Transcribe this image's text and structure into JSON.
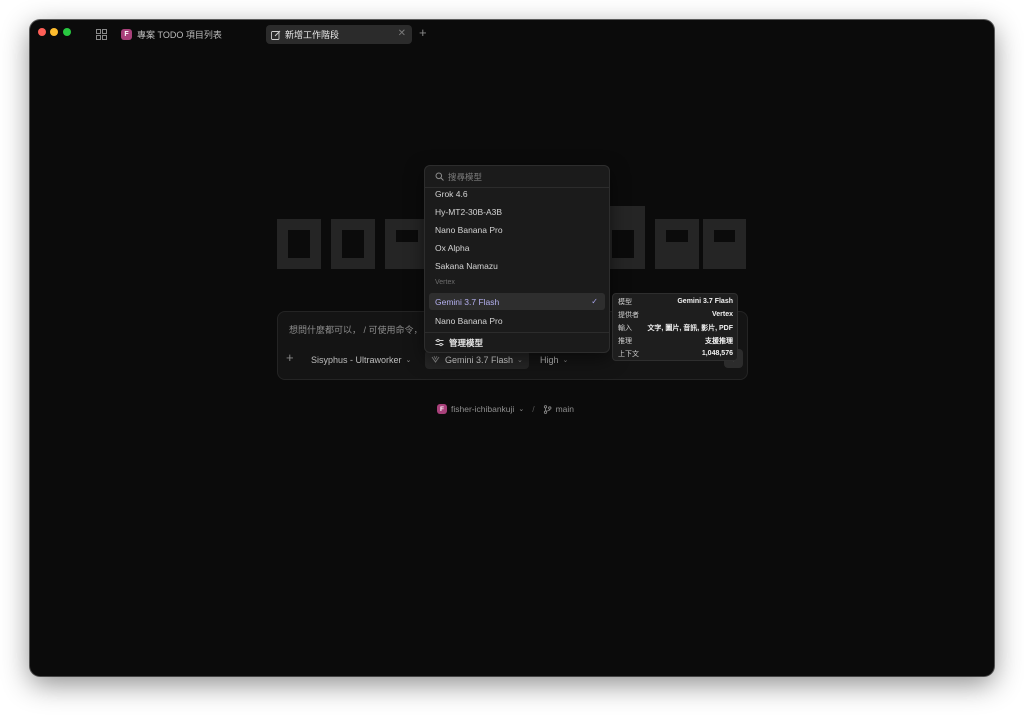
{
  "tabs": [
    {
      "badge": "F",
      "label": "專案 TODO 項目列表"
    },
    {
      "label": "新增工作階段"
    }
  ],
  "new_tab": "+",
  "composer": {
    "prompt": "想問什麼都可以， / 可使用命令， @",
    "add": "+",
    "agent": "Sisyphus - Ultraworker",
    "model": "Gemini 3.7 Flash",
    "effort": "High",
    "send": "↑"
  },
  "project": {
    "badge": "F",
    "name": "fisher-ichibankuji",
    "separator": "/",
    "branch": "main"
  },
  "model_picker": {
    "search_placeholder": "搜尋模型",
    "items": [
      "Grok 4.6",
      "Hy-MT2-30B-A3B",
      "Nano Banana Pro",
      "Ox Alpha",
      "Sakana Namazu"
    ],
    "group": "Vertex",
    "group_items": [
      "Gemini 3.7 Flash",
      "Nano Banana Pro"
    ],
    "manage": "管理模型"
  },
  "model_tooltip": {
    "rows": [
      {
        "key": "模型",
        "value": "Gemini 3.7 Flash"
      },
      {
        "key": "提供者",
        "value": "Vertex"
      },
      {
        "key": "輸入",
        "value": "文字, 圖片, 音訊, 影片, PDF"
      },
      {
        "key": "推理",
        "value": "支援推理"
      },
      {
        "key": "上下文",
        "value": "1,048,576"
      }
    ]
  },
  "colors": {
    "window_bg": "#0b0b0b",
    "accent": "#b4b0f0",
    "badge": "#a8407a"
  }
}
